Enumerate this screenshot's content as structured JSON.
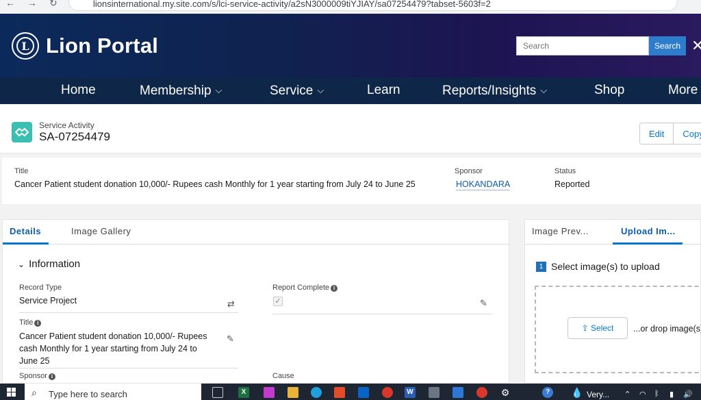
{
  "browser": {
    "url": "lionsinternational.my.site.com/s/lci-service-activity/a2sN3000009tiYJIAY/sa07254479?tabset-5603f=2"
  },
  "header": {
    "brand": "Lion Portal",
    "logo_text": "L",
    "search_placeholder": "Search",
    "search_button": "Search",
    "close_glyph": "✕"
  },
  "nav": {
    "items": [
      {
        "label": "Home",
        "has_menu": false
      },
      {
        "label": "Membership",
        "has_menu": true
      },
      {
        "label": "Service",
        "has_menu": true
      },
      {
        "label": "Learn",
        "has_menu": false
      },
      {
        "label": "Reports/Insights",
        "has_menu": true
      },
      {
        "label": "Shop",
        "has_menu": false
      },
      {
        "label": "More",
        "has_menu": false
      }
    ]
  },
  "record": {
    "kind": "Service Activity",
    "id": "SA-07254479",
    "actions": [
      "Edit",
      "Copy"
    ]
  },
  "highlights": {
    "title_label": "Title",
    "title_value": "Cancer Patient student donation 10,000/- Rupees cash Monthly for 1 year starting from July 24 to June 25",
    "sponsor_label": "Sponsor",
    "sponsor_value": "HOKANDARA",
    "status_label": "Status",
    "status_value": "Reported"
  },
  "details": {
    "tabs": [
      {
        "label": "Details",
        "active": true
      },
      {
        "label": "Image Gallery",
        "active": false
      }
    ],
    "section_title": "Information",
    "fields": {
      "record_type_label": "Record Type",
      "record_type_value": "Service Project",
      "report_complete_label": "Report Complete",
      "report_complete_checked": true,
      "title_label": "Title",
      "title_value": "Cancer Patient student donation 10,000/- Rupees cash Monthly for 1 year starting from July 24 to June 25",
      "sponsor_label": "Sponsor",
      "cause_label": "Cause"
    }
  },
  "upload": {
    "tabs": [
      {
        "label": "Image Prev...",
        "active": false
      },
      {
        "label": "Upload Im...",
        "active": true
      }
    ],
    "step_number": "1",
    "step_label": "Select image(s) to upload",
    "select_button": "Select",
    "drop_text": "...or drop image(s)"
  },
  "taskbar": {
    "search_placeholder": "Type here to search",
    "weather_text": "Very..."
  },
  "colors": {
    "header_dark": "#0e2648",
    "accent_blue": "#0176d3",
    "record_icon_teal": "#3bbfb3"
  }
}
